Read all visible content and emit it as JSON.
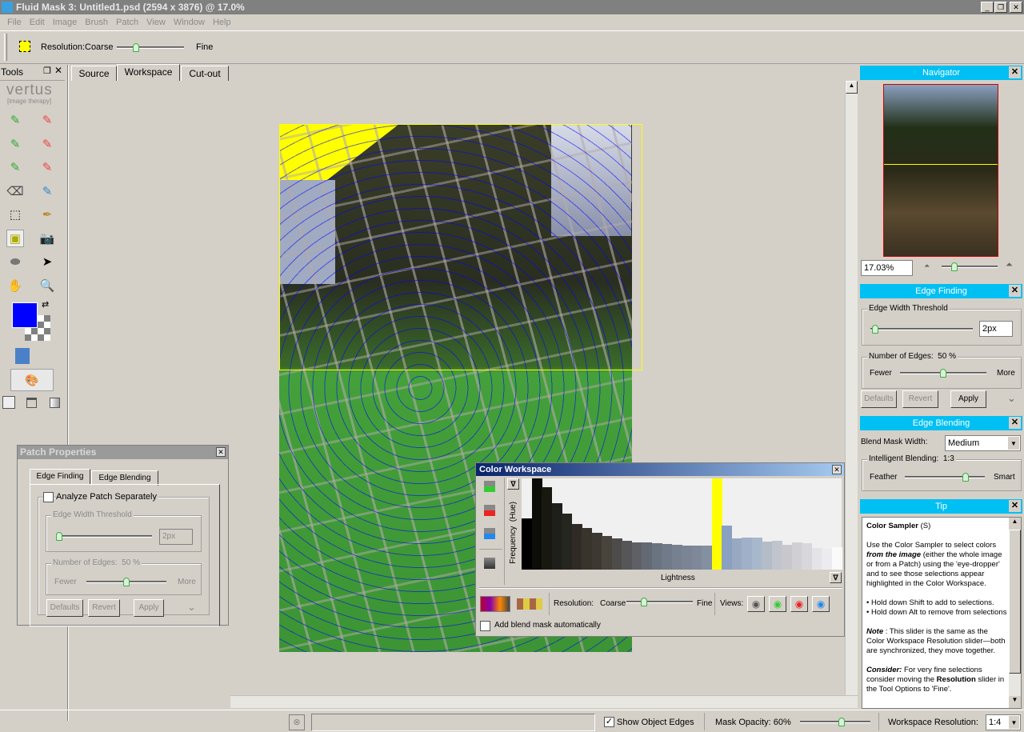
{
  "window": {
    "title": "Fluid Mask 3: Untitled1.psd (2594 x 3876) @ 17.0%"
  },
  "menu": [
    "File",
    "Edit",
    "Image",
    "Brush",
    "Patch",
    "View",
    "Window",
    "Help"
  ],
  "toolbar": {
    "resolution_label": "Resolution:",
    "coarse": "Coarse",
    "fine": "Fine",
    "resolution_value": 0.3
  },
  "tools": {
    "title": "Tools",
    "logo": "vertus",
    "logo_sub": "[image therapy]",
    "icons": [
      "keep-brush-icon",
      "delete-brush-icon",
      "keep-edge-brush-icon",
      "delete-edge-brush-icon",
      "keep-local-brush-icon",
      "delete-local-brush-icon",
      "eraser-icon",
      "blend-brush-icon",
      "patch-select-icon",
      "cutout-pen-icon",
      "color-sampler-icon",
      "camera-icon",
      "stamp-icon",
      "pointer-icon",
      "hand-icon",
      "zoom-icon"
    ],
    "foreground_color": "#0000ff"
  },
  "tabs": [
    "Source",
    "Workspace",
    "Cut-out"
  ],
  "active_tab": "Workspace",
  "navigator": {
    "title": "Navigator",
    "zoom_value": "17.03%",
    "zoom_slider": 0.15
  },
  "edge_finding": {
    "title": "Edge Finding",
    "threshold_label": "Edge Width Threshold",
    "threshold_value": "2px",
    "threshold_slider": 0.02,
    "edges_label": "Number of Edges:",
    "edges_value": "50 %",
    "fewer": "Fewer",
    "more": "More",
    "edges_slider": 0.5,
    "defaults": "Defaults",
    "revert": "Revert",
    "apply": "Apply"
  },
  "edge_blending": {
    "title": "Edge Blending",
    "mask_width_label": "Blend Mask Width:",
    "mask_width_value": "Medium",
    "intelligent_label": "Intelligent Blending:",
    "intelligent_value": "1:3",
    "feather": "Feather",
    "smart": "Smart",
    "slider": 0.75
  },
  "tip": {
    "title": "Tip",
    "heading": "Color Sampler",
    "shortcut": "(S)",
    "p1a": "Use the Color Sampler to select colors ",
    "p1b": "from the image",
    "p1c": " (either the whole image or from a Patch) using the 'eye-dropper' and to see those selections appear highlighted in the Color Workspace.",
    "b1": "• Hold down Shift to add to selections.",
    "b2": "• Hold down Alt to remove from selections",
    "note_label": "Note",
    "note": " : This slider is the same as the Color Workspace Resolution slider—both are synchronized, they move together.",
    "consider_label": "Consider:",
    "consider_a": " For very fine selections consider moving the ",
    "consider_b": "Resolution",
    "consider_c": " slider in the Tool Options to 'Fine'."
  },
  "patch_properties": {
    "title": "Patch Properties",
    "tab1": "Edge Finding",
    "tab2": "Edge Blending",
    "analyze_label": "Analyze Patch Separately",
    "analyze_checked": false,
    "threshold_label": "Edge Width Threshold",
    "threshold_value": "2px",
    "edges_label": "Number of Edges:",
    "edges_value": "50 %",
    "fewer": "Fewer",
    "more": "More",
    "defaults": "Defaults",
    "revert": "Revert",
    "apply": "Apply"
  },
  "color_workspace": {
    "title": "Color Workspace",
    "y_label": "Frequency  (Hue)",
    "x_label": "Lightness",
    "resolution_label": "Resolution:",
    "coarse": "Coarse",
    "fine": "Fine",
    "views_label": "Views:",
    "resolution_value": 0.25,
    "blend_label": "Add blend mask automatically",
    "blend_checked": false,
    "histogram": {
      "values": [
        0.56,
        1.0,
        0.9,
        0.73,
        0.61,
        0.5,
        0.455,
        0.4,
        0.37,
        0.34,
        0.32,
        0.3,
        0.3,
        0.29,
        0.28,
        0.27,
        0.26,
        0.26,
        0.26,
        1.0,
        0.48,
        0.34,
        0.35,
        0.35,
        0.31,
        0.32,
        0.27,
        0.3,
        0.29,
        0.24,
        0.23,
        0.25
      ],
      "colors": [
        "#000000",
        "#0c0c08",
        "#181810",
        "#1e1e1a",
        "#262620",
        "#302a26",
        "#38342c",
        "#3e3832",
        "#48443c",
        "#4e4c4a",
        "#565658",
        "#5e6066",
        "#646a74",
        "#6a7380",
        "#707a88",
        "#76808e",
        "#7a8494",
        "#7e8898",
        "#8290a0",
        "#ffff00",
        "#8aa0c0",
        "#98a8c0",
        "#a0b0c8",
        "#a8b8cc",
        "#b4bcc8",
        "#c0c4cc",
        "#c8c8cc",
        "#d0d0d4",
        "#d8d8dc",
        "#e4e4e8",
        "#ececf0",
        "#fafafa"
      ],
      "selected_bin": 19
    }
  },
  "status": {
    "show_edges_label": "Show Object Edges",
    "show_edges_checked": true,
    "mask_opacity_label": "Mask Opacity: 60%",
    "mask_opacity": 0.6,
    "workspace_res_label": "Workspace Resolution:",
    "workspace_res_value": "1:4"
  }
}
